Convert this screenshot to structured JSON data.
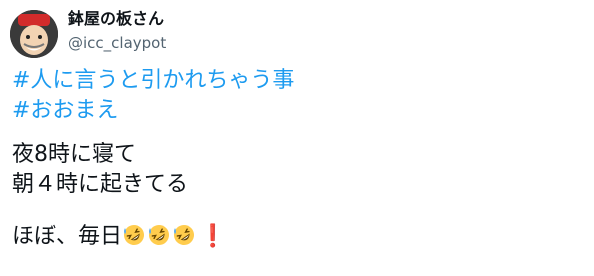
{
  "author": {
    "display_name": "鉢屋の板さん",
    "handle": "@icc_claypot",
    "avatar_icon": "chef-avatar-icon"
  },
  "tweet": {
    "hashtags": [
      "#人に言うと引かれちゃう事",
      "#おおまえ"
    ],
    "lines": [
      "夜8時に寝て",
      "朝４時に起きてる"
    ],
    "final_line": {
      "text": "ほぼ、毎日",
      "emojis": [
        "rolling-on-floor-laughing-icon",
        "rolling-on-floor-laughing-icon",
        "rolling-on-floor-laughing-icon"
      ],
      "exclamation": "❗"
    }
  },
  "colors": {
    "hashtag": "#1d9bf0",
    "text": "#0f1419",
    "handle": "#536471",
    "exclamation": "#e0245e"
  }
}
